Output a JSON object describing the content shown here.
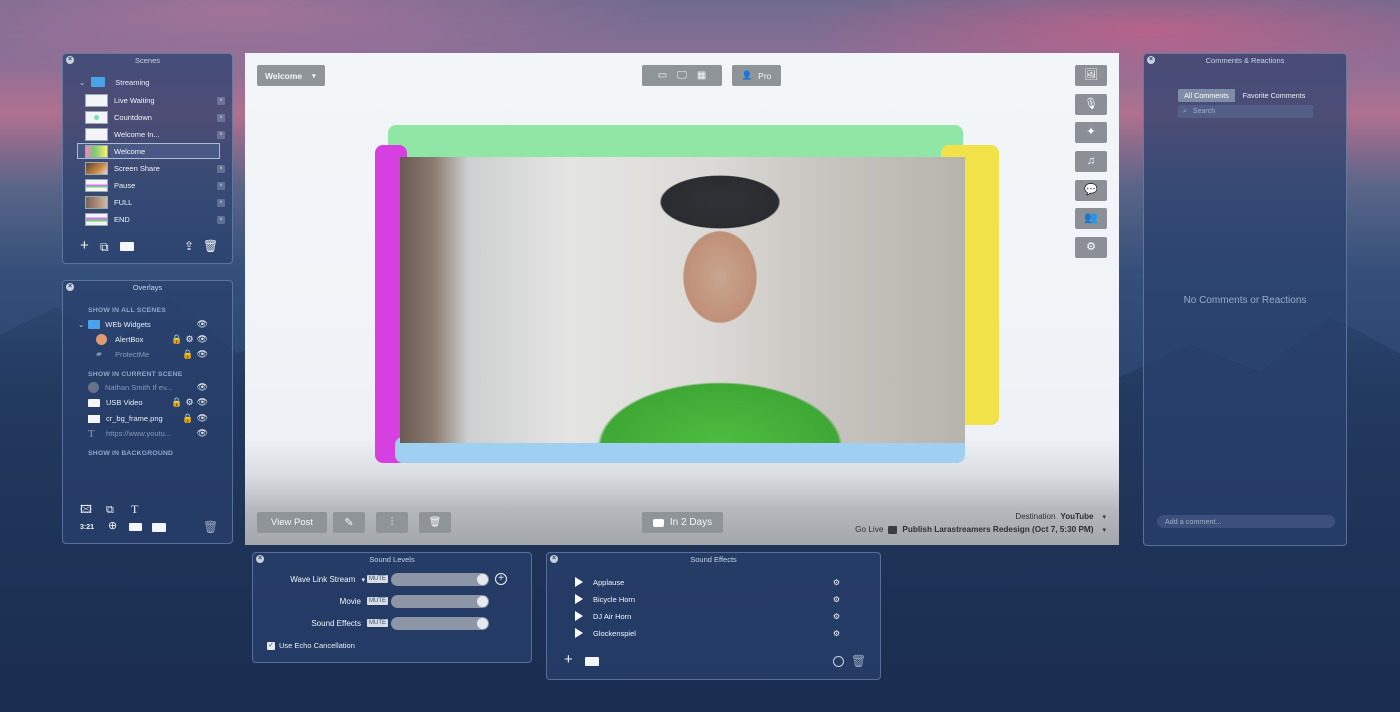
{
  "scenes": {
    "title": "Scenes",
    "folder": "Streaming",
    "items": [
      {
        "label": "Live Waiting"
      },
      {
        "label": "Countdown"
      },
      {
        "label": "Welcome In..."
      },
      {
        "label": "Welcome"
      },
      {
        "label": "Screen Share"
      },
      {
        "label": "Pause"
      },
      {
        "label": "FULL"
      },
      {
        "label": "END"
      }
    ]
  },
  "overlays": {
    "title": "Overlays",
    "header_all": "SHOW IN ALL SCENES",
    "folder": "WEb Widgets",
    "widgets": [
      {
        "label": "AlertBox"
      },
      {
        "label": "ProtectMe"
      }
    ],
    "header_current": "SHOW IN CURRENT SCENE",
    "current": [
      {
        "label": "Nathan Smith If ev..."
      },
      {
        "label": "USB Video"
      },
      {
        "label": "cr_bg_frame.png"
      },
      {
        "label": "https://www.youtu..."
      }
    ],
    "header_background": "SHOW IN BACKGROUND",
    "ratio_label": "3:21"
  },
  "stage": {
    "scene_select": "Welcome",
    "pro_label": "Pro",
    "view_post": "View Post",
    "schedule": "In 2 Days",
    "destination_label": "Destination",
    "destination_value": "YouTube",
    "go_live_label": "Go Live",
    "go_live_value": "Publish Larastreamers Redesign (Oct 7, 5:30 PM)"
  },
  "comments": {
    "title": "Comments & Reactions",
    "tab_all": "All Comments",
    "tab_fav": "Favorite Comments",
    "search_placeholder": "Search",
    "empty": "No Comments or Reactions",
    "add_placeholder": "Add a comment..."
  },
  "sound_levels": {
    "title": "Sound Levels",
    "mute": "MUTE",
    "rows": [
      {
        "label": "Wave Link Stream",
        "level": 1.0
      },
      {
        "label": "Movie",
        "level": 1.0
      },
      {
        "label": "Sound Effects",
        "level": 1.0
      }
    ],
    "echo": "Use Echo Cancellation"
  },
  "sound_effects": {
    "title": "Sound Effects",
    "items": [
      {
        "label": "Applause"
      },
      {
        "label": "Bicycle Horn"
      },
      {
        "label": "DJ Air Horn"
      },
      {
        "label": "Glockenspiel"
      }
    ]
  }
}
